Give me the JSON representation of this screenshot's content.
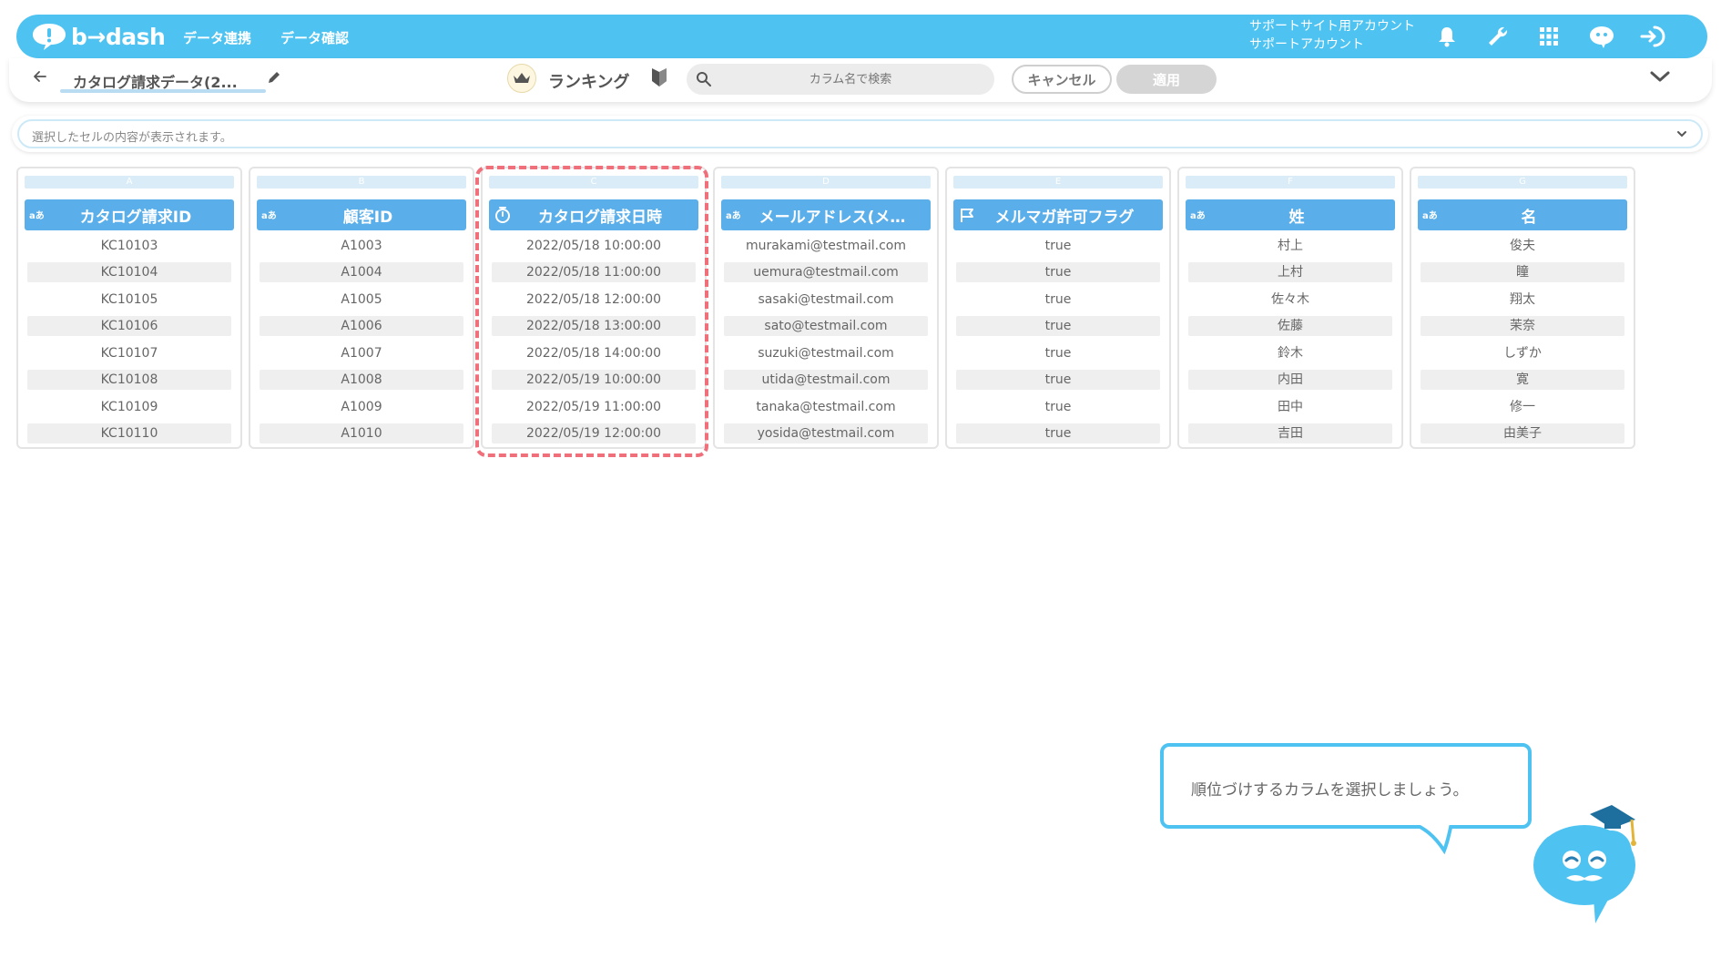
{
  "header": {
    "brand": "b→dash",
    "nav": [
      "データ連携",
      "データ確認"
    ],
    "account_line1": "サポートサイト用アカウント",
    "account_line2": "サポートアカウント"
  },
  "toolbar": {
    "dataset_name": "カタログ請求データ(2...",
    "ranking_label": "ランキング",
    "search_placeholder": "カラム名で検索",
    "cancel_label": "キャンセル",
    "apply_label": "適用"
  },
  "cell_bar": {
    "placeholder": "選択したセルの内容が表示されます。"
  },
  "columns": [
    {
      "letter": "A",
      "type": "text",
      "name": "カタログ請求ID",
      "values": [
        "KC10103",
        "KC10104",
        "KC10105",
        "KC10106",
        "KC10107",
        "KC10108",
        "KC10109",
        "KC10110"
      ]
    },
    {
      "letter": "B",
      "type": "text",
      "name": "顧客ID",
      "values": [
        "A1003",
        "A1004",
        "A1005",
        "A1006",
        "A1007",
        "A1008",
        "A1009",
        "A1010"
      ]
    },
    {
      "letter": "C",
      "type": "datetime",
      "name": "カタログ請求日時",
      "values": [
        "2022/05/18 10:00:00",
        "2022/05/18 11:00:00",
        "2022/05/18 12:00:00",
        "2022/05/18 13:00:00",
        "2022/05/18 14:00:00",
        "2022/05/19 10:00:00",
        "2022/05/19 11:00:00",
        "2022/05/19 12:00:00"
      ]
    },
    {
      "letter": "D",
      "type": "text",
      "name": "メールアドレス(メ…",
      "values": [
        "murakami@testmail.com",
        "uemura@testmail.com",
        "sasaki@testmail.com",
        "sato@testmail.com",
        "suzuki@testmail.com",
        "utida@testmail.com",
        "tanaka@testmail.com",
        "yosida@testmail.com"
      ]
    },
    {
      "letter": "E",
      "type": "boolean",
      "name": "メルマガ許可フラグ",
      "values": [
        "true",
        "true",
        "true",
        "true",
        "true",
        "true",
        "true",
        "true"
      ]
    },
    {
      "letter": "F",
      "type": "text",
      "name": "姓",
      "values": [
        "村上",
        "上村",
        "佐々木",
        "佐藤",
        "鈴木",
        "内田",
        "田中",
        "吉田"
      ]
    },
    {
      "letter": "G",
      "type": "text",
      "name": "名",
      "values": [
        "俊夫",
        "瞳",
        "翔太",
        "茉奈",
        "しずか",
        "寛",
        "修一",
        "由美子"
      ]
    }
  ],
  "type_badge_text": "aあ",
  "guide": {
    "message": "順位づけするカラムを選択しましょう。"
  },
  "colors": {
    "brand": "#4ec3f2",
    "column_header": "#5aaee9",
    "highlight": "#ef6f7a"
  }
}
